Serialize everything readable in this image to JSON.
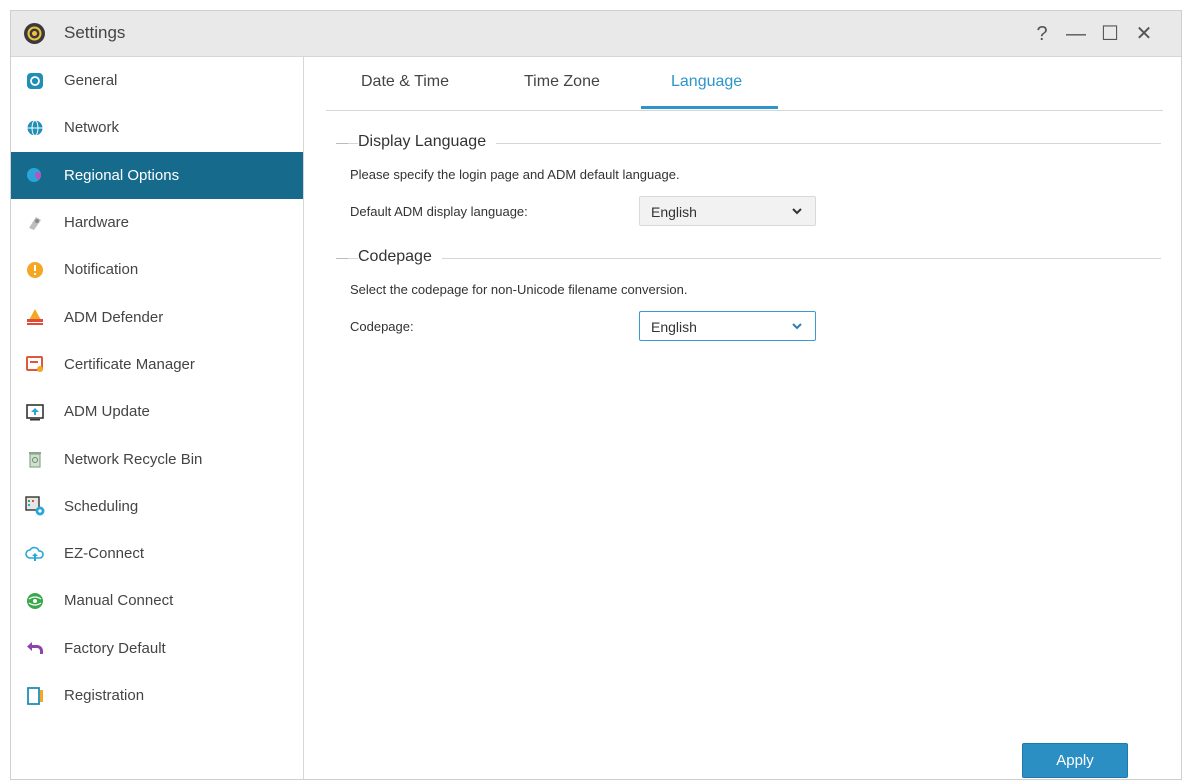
{
  "window": {
    "title": "Settings",
    "controls": {
      "help": "?",
      "minimize": "—",
      "maximize": "☐",
      "close": "✕"
    }
  },
  "sidebar": {
    "items": [
      {
        "label": "General",
        "icon": "general-icon",
        "color": "#1f8fb6"
      },
      {
        "label": "Network",
        "icon": "globe-icon",
        "color": "#1f8fb6"
      },
      {
        "label": "Regional Options",
        "icon": "regional-icon",
        "color": "#2aa7d8",
        "active": true
      },
      {
        "label": "Hardware",
        "icon": "hardware-icon",
        "color": "#8a8a8a"
      },
      {
        "label": "Notification",
        "icon": "notification-icon",
        "color": "#f5a623"
      },
      {
        "label": "ADM Defender",
        "icon": "defender-icon",
        "color": "#e24b3b"
      },
      {
        "label": "Certificate Manager",
        "icon": "certificate-icon",
        "color": "#e2553b"
      },
      {
        "label": "ADM Update",
        "icon": "update-icon",
        "color": "#333333"
      },
      {
        "label": "Network Recycle Bin",
        "icon": "recycle-bin-icon",
        "color": "#8aa88a"
      },
      {
        "label": "Scheduling",
        "icon": "scheduling-icon",
        "color": "#2aa7d8"
      },
      {
        "label": "EZ-Connect",
        "icon": "cloud-icon",
        "color": "#2aa7d8"
      },
      {
        "label": "Manual Connect",
        "icon": "manual-connect-icon",
        "color": "#3aa84a"
      },
      {
        "label": "Factory Default",
        "icon": "undo-icon",
        "color": "#8e44ad"
      },
      {
        "label": "Registration",
        "icon": "registration-icon",
        "color": "#1f8fb6"
      }
    ]
  },
  "tabs": [
    {
      "label": "Date & Time"
    },
    {
      "label": "Time Zone"
    },
    {
      "label": "Language",
      "active": true
    }
  ],
  "display_language": {
    "title": "Display Language",
    "description": "Please specify the login page and ADM default language.",
    "field_label": "Default ADM display language:",
    "value": "English"
  },
  "codepage": {
    "title": "Codepage",
    "description": "Select the codepage for non-Unicode filename conversion.",
    "field_label": "Codepage:",
    "value": "English"
  },
  "apply_label": "Apply",
  "colors": {
    "accent": "#2c95c9",
    "sidebar_active": "#166a8c",
    "apply_button": "#2b8fc4"
  }
}
